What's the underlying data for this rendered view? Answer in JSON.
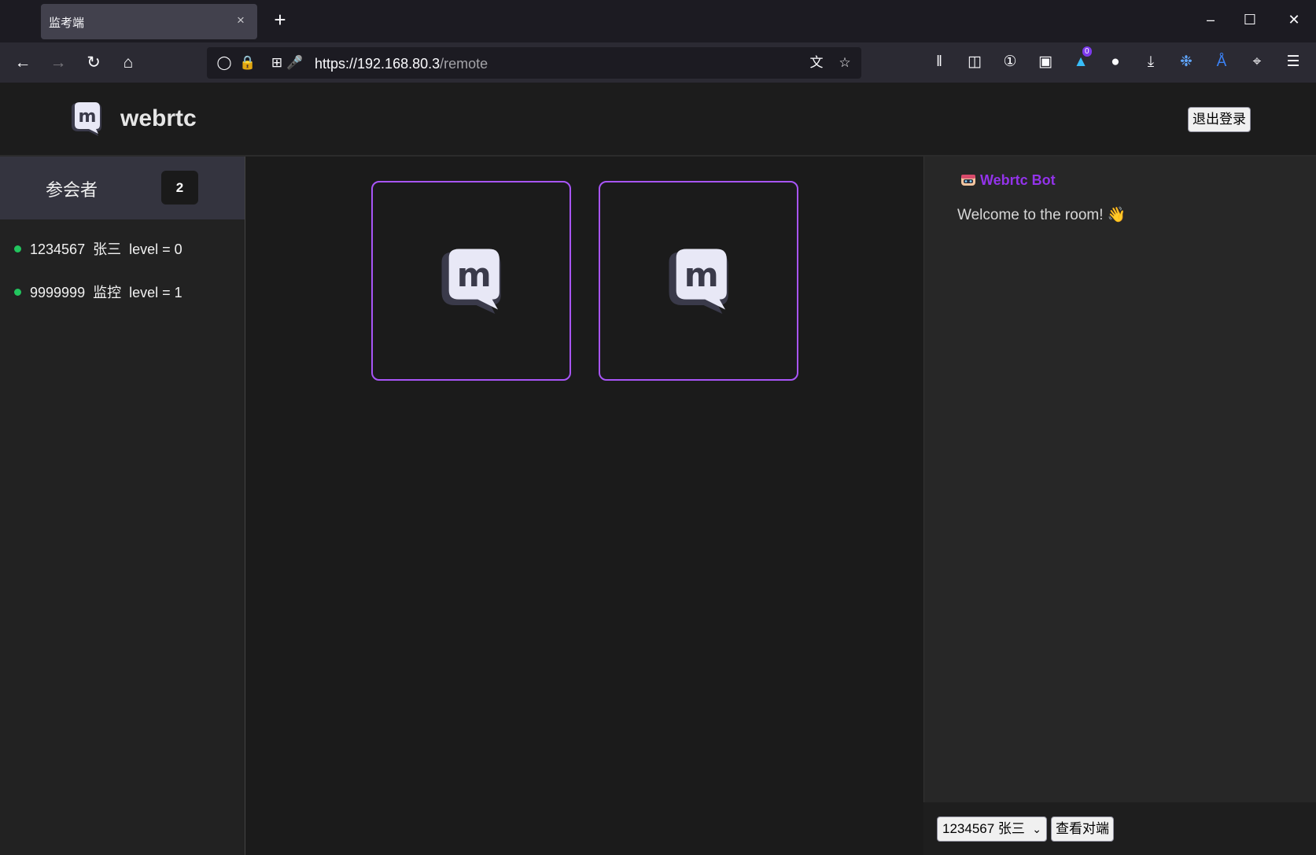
{
  "browser": {
    "tab_title": "监考端",
    "tab_close": "×",
    "new_tab": "+",
    "url_host": "https://192.168.80.3",
    "url_path": "/remote",
    "notification_count": "0"
  },
  "header": {
    "brand": "webrtc",
    "logout_label": "退出登录"
  },
  "sidebar": {
    "title": "参会者",
    "count": "2",
    "participants": [
      {
        "id": "1234567",
        "name": "张三",
        "level": "level = 0"
      },
      {
        "id": "9999999",
        "name": "监控",
        "level": "level = 1"
      }
    ]
  },
  "chat": {
    "bot_name": "Webrtc Bot",
    "messages": [
      {
        "text": "Welcome to the room! 👋"
      }
    ]
  },
  "footer": {
    "selected_peer": "1234567 张三",
    "view_button": "查看对端"
  },
  "colors": {
    "tile_border": "#a855f7",
    "online_dot": "#22c55e",
    "bot_name": "#9333ea"
  }
}
